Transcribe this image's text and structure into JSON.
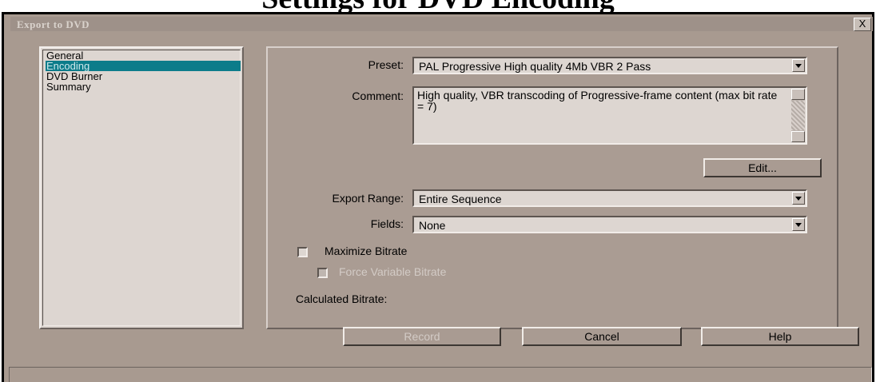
{
  "page_heading": "Settings for DVD Encoding",
  "window": {
    "title": "Export to DVD",
    "close_label": "X"
  },
  "nav": {
    "items": [
      {
        "label": "General"
      },
      {
        "label": "Encoding"
      },
      {
        "label": "DVD Burner"
      },
      {
        "label": "Summary"
      }
    ],
    "selected": "Encoding"
  },
  "encoding": {
    "preset_label": "Preset:",
    "preset_value": "PAL Progressive High quality 4Mb VBR 2 Pass",
    "comment_label": "Comment:",
    "comment_value": "High quality, VBR transcoding of Progressive-frame content (max bit rate = 7)",
    "edit_button": "Edit...",
    "export_range_label": "Export Range:",
    "export_range_value": "Entire Sequence",
    "fields_label": "Fields:",
    "fields_value": "None",
    "maximize_bitrate_label": "Maximize Bitrate",
    "force_vbr_label": "Force Variable Bitrate",
    "calculated_bitrate_label": "Calculated Bitrate:"
  },
  "footer": {
    "record": "Record",
    "cancel": "Cancel",
    "help": "Help"
  },
  "colors": {
    "selection": "#0c7c8a",
    "dialog_bg": "#a89a90",
    "field_bg": "#ddd6d1"
  }
}
